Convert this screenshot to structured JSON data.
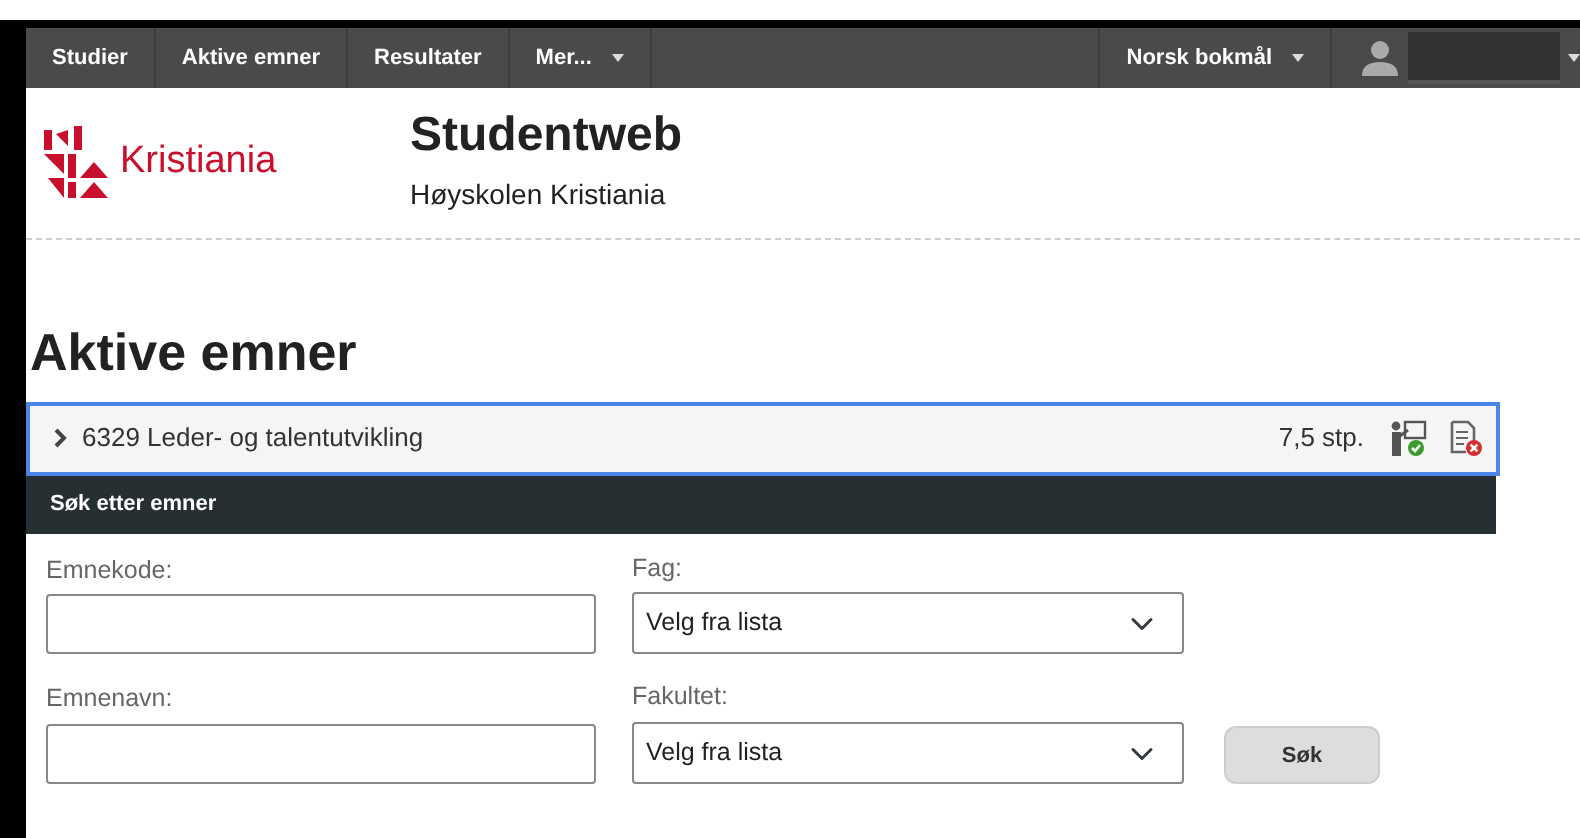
{
  "navbar": {
    "items": [
      {
        "label": "Studier",
        "dropdown": false
      },
      {
        "label": "Aktive emner",
        "dropdown": false
      },
      {
        "label": "Resultater",
        "dropdown": false
      },
      {
        "label": "Mer...",
        "dropdown": true
      }
    ],
    "language": {
      "label": "Norsk bokmål"
    }
  },
  "header": {
    "logo_text": "Kristiania",
    "title": "Studentweb",
    "subtitle": "Høyskolen Kristiania"
  },
  "page_title": "Aktive emner",
  "courses": [
    {
      "name": "6329 Leder- og talentutvikling",
      "credits": "7,5 stp.",
      "expanded": false
    }
  ],
  "search_panel": {
    "title": "Søk etter emner",
    "fields": [
      {
        "kind": "text",
        "label": "Emnekode:"
      },
      {
        "kind": "select",
        "label": "Fag:",
        "value": "Velg fra lista"
      },
      {
        "kind": "text",
        "label": "Emnenavn:"
      },
      {
        "kind": "select",
        "label": "Fakultet:",
        "value": "Velg fra lista"
      }
    ],
    "button": "Søk"
  }
}
